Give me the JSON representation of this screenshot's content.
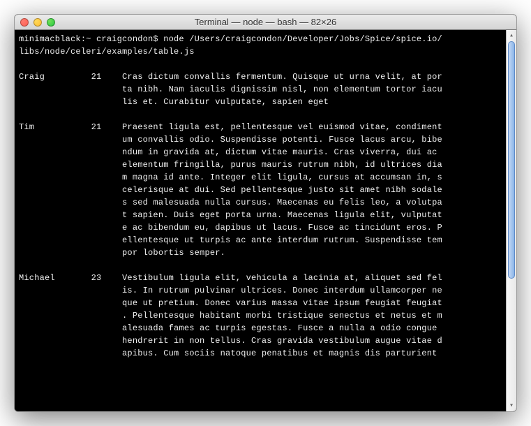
{
  "window": {
    "title": "Terminal — node — bash — 82×26"
  },
  "prompt": {
    "host": "minimacblack",
    "path": "~",
    "user": "craigcondon",
    "symbol": "$",
    "command": "node /Users/craigcondon/Developer/Jobs/Spice/spice.io/libs/node/celeri/examples/table.js"
  },
  "table": {
    "rows": [
      {
        "name": "Craig",
        "age": "21",
        "text": "Cras dictum convallis fermentum. Quisque ut urna velit, at porta nibh. Nam iaculis dignissim nisl, non elementum tortor iaculis et. Curabitur vulputate, sapien eget"
      },
      {
        "name": "Tim",
        "age": "21",
        "text": "Praesent ligula est, pellentesque vel euismod vitae, condimentum convallis odio. Suspendisse potenti. Fusce lacus arcu, bibendum in gravida at, dictum vitae mauris. Cras viverra, dui ac elementum fringilla, purus mauris rutrum nibh, id ultrices diam magna id ante. Integer elit ligula, cursus at accumsan in, scelerisque at dui. Sed pellentesque justo sit amet nibh sodales sed malesuada nulla cursus. Maecenas eu felis leo, a volutpat sapien. Duis eget porta urna. Maecenas ligula elit, vulputate ac bibendum eu, dapibus ut lacus. Fusce ac tincidunt eros. Pellentesque ut turpis ac ante interdum rutrum. Suspendisse tempor lobortis semper."
      },
      {
        "name": "Michael",
        "age": "23",
        "text": "Vestibulum ligula elit, vehicula a lacinia at, aliquet sed felis. In rutrum pulvinar ultrices. Donec interdum ullamcorper neque ut pretium. Donec varius massa vitae ipsum feugiat feugiat. Pellentesque habitant morbi tristique senectus et netus et malesuada fames ac turpis egestas. Fusce a nulla a odio congue hendrerit in non tellus. Cras gravida vestibulum augue vitae dapibus. Cum sociis natoque penatibus et magnis dis parturient"
      }
    ]
  }
}
